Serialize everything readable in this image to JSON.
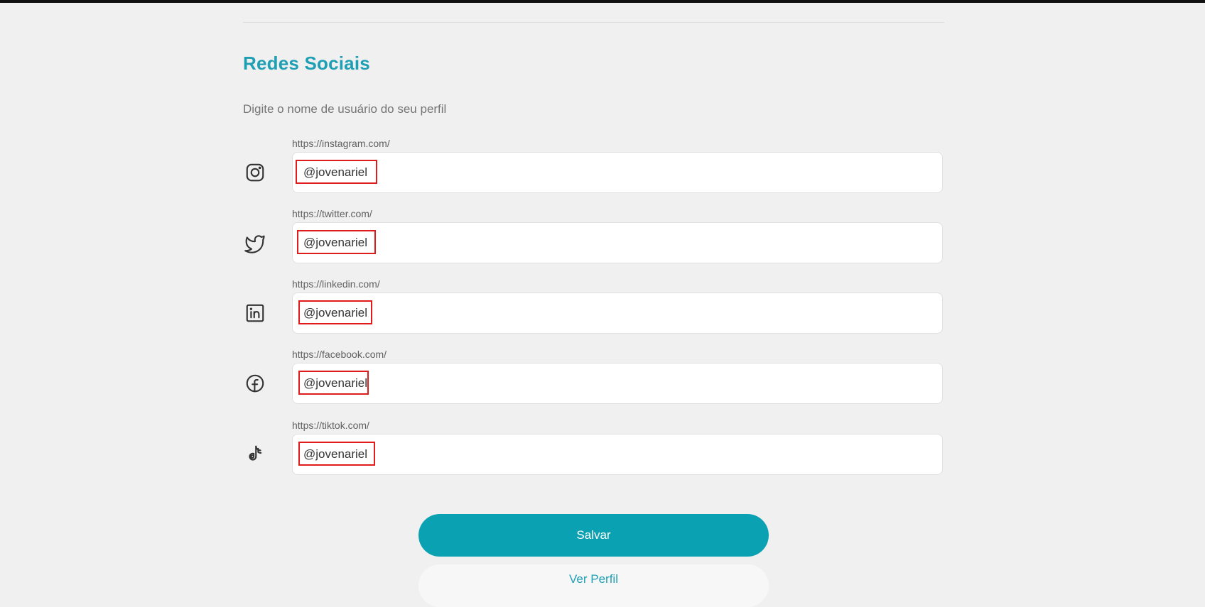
{
  "section": {
    "title": "Redes Sociais",
    "subtitle": "Digite o nome de usuário do seu perfil"
  },
  "socials": [
    {
      "network": "instagram",
      "icon": "instagram-icon",
      "url_prefix": "https://instagram.com/",
      "value": "@jovenariel"
    },
    {
      "network": "twitter",
      "icon": "twitter-icon",
      "url_prefix": "https://twitter.com/",
      "value": "@jovenariel"
    },
    {
      "network": "linkedin",
      "icon": "linkedin-icon",
      "url_prefix": "https://linkedin.com/",
      "value": "@jovenariel"
    },
    {
      "network": "facebook",
      "icon": "facebook-icon",
      "url_prefix": "https://facebook.com/",
      "value": "@jovenariel"
    },
    {
      "network": "tiktok",
      "icon": "tiktok-icon",
      "url_prefix": "https://tiktok.com/",
      "value": "@jovenariel"
    }
  ],
  "actions": {
    "save_label": "Salvar",
    "view_profile_label": "Ver Perfil"
  },
  "colors": {
    "accent": "#1e9fb4",
    "primary_button": "#0aa2b3",
    "highlight_box": "#e01b1b",
    "background": "#f0f0f0"
  }
}
